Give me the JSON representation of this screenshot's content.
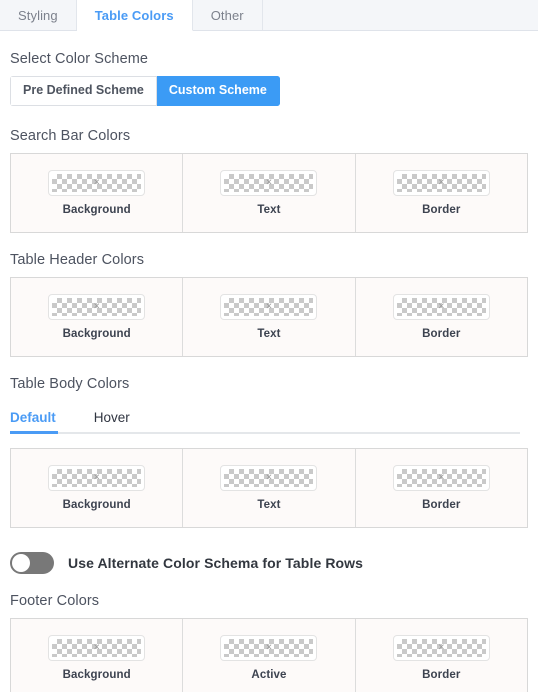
{
  "theme": {
    "accent": "#3b9bf5",
    "tab_inactive_bg": "#f4f6f9",
    "panel_bg": "#fdfaf9",
    "panel_border": "#d8d8d8",
    "heading_color": "#4d5360",
    "toggle_off_track": "#787878"
  },
  "tabs": [
    {
      "label": "Styling",
      "active": false
    },
    {
      "label": "Table Colors",
      "active": true
    },
    {
      "label": "Other",
      "active": false
    }
  ],
  "select_color_scheme": {
    "title": "Select Color Scheme",
    "options": [
      {
        "label": "Pre Defined Scheme",
        "active": false
      },
      {
        "label": "Custom Scheme",
        "active": true
      }
    ]
  },
  "search_bar_colors": {
    "title": "Search Bar Colors",
    "cells": [
      {
        "label": "Background",
        "value": "transparent",
        "icon": "transparent-swatch-icon"
      },
      {
        "label": "Text",
        "value": "transparent",
        "icon": "transparent-swatch-icon"
      },
      {
        "label": "Border",
        "value": "transparent",
        "icon": "transparent-swatch-icon"
      }
    ]
  },
  "table_header_colors": {
    "title": "Table Header Colors",
    "cells": [
      {
        "label": "Background",
        "value": "transparent",
        "icon": "transparent-swatch-icon"
      },
      {
        "label": "Text",
        "value": "transparent",
        "icon": "transparent-swatch-icon"
      },
      {
        "label": "Border",
        "value": "transparent",
        "icon": "transparent-swatch-icon"
      }
    ]
  },
  "table_body_colors": {
    "title": "Table Body Colors",
    "subtabs": [
      {
        "label": "Default",
        "active": true
      },
      {
        "label": "Hover",
        "active": false
      }
    ],
    "cells": [
      {
        "label": "Background",
        "value": "transparent",
        "icon": "transparent-swatch-icon"
      },
      {
        "label": "Text",
        "value": "transparent",
        "icon": "transparent-swatch-icon"
      },
      {
        "label": "Border",
        "value": "transparent",
        "icon": "transparent-swatch-icon"
      }
    ]
  },
  "alternate_rows_toggle": {
    "label": "Use Alternate Color Schema for Table Rows",
    "state": "off"
  },
  "footer_colors": {
    "title": "Footer Colors",
    "cells": [
      {
        "label": "Background",
        "value": "transparent",
        "icon": "transparent-swatch-icon"
      },
      {
        "label": "Active",
        "value": "transparent",
        "icon": "transparent-swatch-icon"
      },
      {
        "label": "Border",
        "value": "transparent",
        "icon": "transparent-swatch-icon"
      }
    ]
  }
}
